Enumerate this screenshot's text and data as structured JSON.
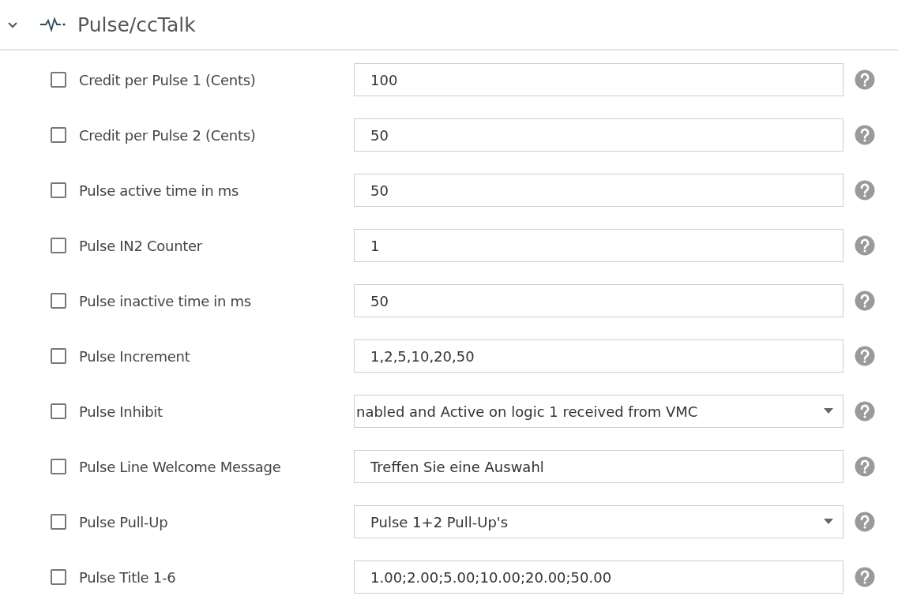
{
  "section": {
    "title": "Pulse/ccTalk",
    "expanded": true
  },
  "settings": [
    {
      "label": "Credit per Pulse 1 (Cents)",
      "checked": false,
      "kind": "text",
      "value": "100"
    },
    {
      "label": "Credit per Pulse 2 (Cents)",
      "checked": false,
      "kind": "text",
      "value": "50"
    },
    {
      "label": "Pulse active time in ms",
      "checked": false,
      "kind": "text",
      "value": "50"
    },
    {
      "label": "Pulse IN2 Counter",
      "checked": false,
      "kind": "text",
      "value": "1"
    },
    {
      "label": "Pulse inactive time in ms",
      "checked": false,
      "kind": "text",
      "value": "50"
    },
    {
      "label": "Pulse Increment",
      "checked": false,
      "kind": "text",
      "value": "1,2,5,10,20,50"
    },
    {
      "label": "Pulse Inhibit",
      "checked": false,
      "kind": "select",
      "value": "nabled and Active on logic 1 received from VMC"
    },
    {
      "label": "Pulse Line Welcome Message",
      "checked": false,
      "kind": "text",
      "value": "Treffen Sie eine Auswahl"
    },
    {
      "label": "Pulse Pull-Up",
      "checked": false,
      "kind": "select",
      "value": "Pulse 1+2 Pull-Up's"
    },
    {
      "label": "Pulse Title 1-6",
      "checked": false,
      "kind": "text",
      "value": "1.00;2.00;5.00;10.00;20.00;50.00"
    }
  ]
}
